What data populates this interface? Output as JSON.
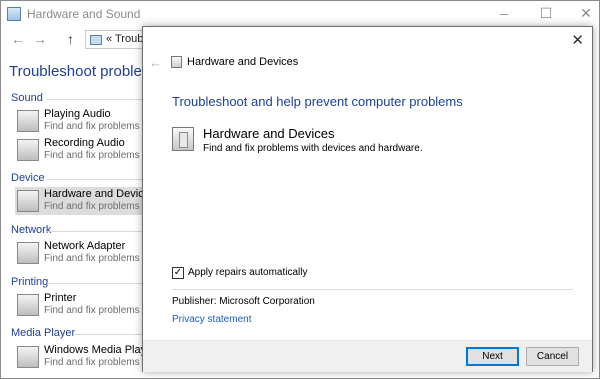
{
  "background_window": {
    "title": "Hardware and Sound",
    "controls": {
      "minimize": "–",
      "maximize": "☐",
      "close": "✕"
    },
    "nav": {
      "back": "←",
      "forward": "→",
      "up": "↑"
    },
    "address": {
      "prefix": "«",
      "text": "Troubleshooting"
    },
    "heading": "Troubleshoot problems - Hardware and Sound",
    "categories": [
      {
        "label": "Sound",
        "items": [
          {
            "title": "Playing Audio",
            "desc": "Find and fix problems with playing sound"
          },
          {
            "title": "Recording Audio",
            "desc": "Find and fix problems with recording sound"
          }
        ]
      },
      {
        "label": "Device",
        "items": [
          {
            "title": "Hardware and Devices",
            "desc": "Find and fix problems with devices"
          }
        ]
      },
      {
        "label": "Network",
        "items": [
          {
            "title": "Network Adapter",
            "desc": "Find and fix problems with network adapters"
          }
        ]
      },
      {
        "label": "Printing",
        "items": [
          {
            "title": "Printer",
            "desc": "Find and fix problems with printing"
          }
        ]
      },
      {
        "label": "Media Player",
        "items": [
          {
            "title": "Windows Media Player DVD",
            "desc": "Find and fix problems with playing DVDs"
          }
        ]
      }
    ]
  },
  "dialog": {
    "close": "✕",
    "back": "←",
    "title": "Hardware and Devices",
    "heading": "Troubleshoot and help prevent computer problems",
    "troubleshooter": {
      "name": "Hardware and Devices",
      "description": "Find and fix problems with devices and hardware."
    },
    "apply_repairs": {
      "label": "Apply repairs automatically",
      "checked": true,
      "mark": "✓"
    },
    "publisher": "Publisher:  Microsoft Corporation",
    "privacy": "Privacy statement",
    "buttons": {
      "next": "Next",
      "cancel": "Cancel"
    },
    "colors": {
      "accent": "#1e3f99",
      "link": "#1a5fb4",
      "focus": "#0078d7"
    }
  }
}
